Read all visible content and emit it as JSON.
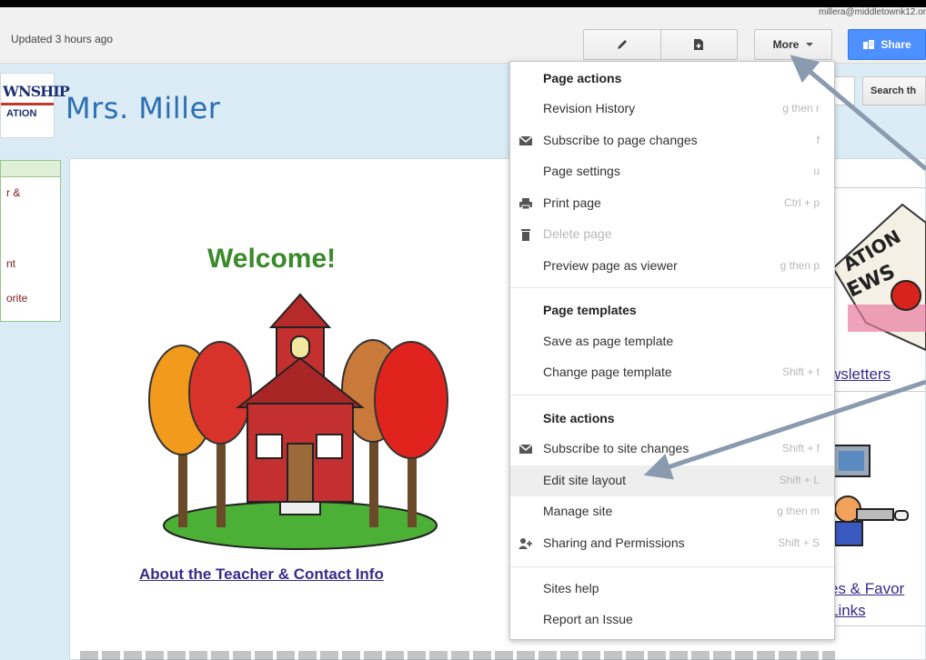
{
  "toolbar": {
    "user_email": "millera@middletownk12.or",
    "updated": "Updated 3 hours ago",
    "more_label": "More",
    "share_label": "Share"
  },
  "site": {
    "logo_top": "WNSHIP",
    "logo_bottom": "ATION",
    "title": "Mrs. Miller",
    "search_button": "Search th",
    "sidebar_items": [
      "r &",
      "nt",
      "orite"
    ],
    "welcome": "Welcome!",
    "about_link": "About the Teacher & Contact Info",
    "newsletters_link": "wsletters",
    "favor_link": "es & Favor",
    "links_link": "Links",
    "news_text": "ATION",
    "news_text2": "EWS"
  },
  "menu": {
    "page_actions_heading": "Page actions",
    "page_actions": [
      {
        "label": "Revision History",
        "shortcut": "g then r",
        "icon": "none"
      },
      {
        "label": "Subscribe to page changes",
        "shortcut": "f",
        "icon": "envelope-icon"
      },
      {
        "label": "Page settings",
        "shortcut": "u",
        "icon": "none"
      },
      {
        "label": "Print page",
        "shortcut": "Ctrl + p",
        "icon": "printer-icon"
      },
      {
        "label": "Delete page",
        "shortcut": "",
        "icon": "trash-icon",
        "disabled": true
      },
      {
        "label": "Preview page as viewer",
        "shortcut": "g then p",
        "icon": "none"
      }
    ],
    "page_templates_heading": "Page templates",
    "page_templates": [
      {
        "label": "Save as page template",
        "shortcut": ""
      },
      {
        "label": "Change page template",
        "shortcut": "Shift + t"
      }
    ],
    "site_actions_heading": "Site actions",
    "site_actions": [
      {
        "label": "Subscribe to site changes",
        "shortcut": "Shift + f",
        "icon": "envelope-icon"
      },
      {
        "label": "Edit site layout",
        "shortcut": "Shift + L",
        "icon": "none",
        "highlighted": true
      },
      {
        "label": "Manage site",
        "shortcut": "g then m",
        "icon": "none"
      },
      {
        "label": "Sharing and Permissions",
        "shortcut": "Shift + S",
        "icon": "add-person-icon"
      }
    ],
    "help": [
      {
        "label": "Sites help",
        "shortcut": ""
      },
      {
        "label": "Report an Issue",
        "shortcut": ""
      }
    ]
  },
  "colors": {
    "accent_share": "#4d90fe",
    "welcome_green": "#3a8a2a",
    "annotation_arrow": "#8a9bb0"
  }
}
